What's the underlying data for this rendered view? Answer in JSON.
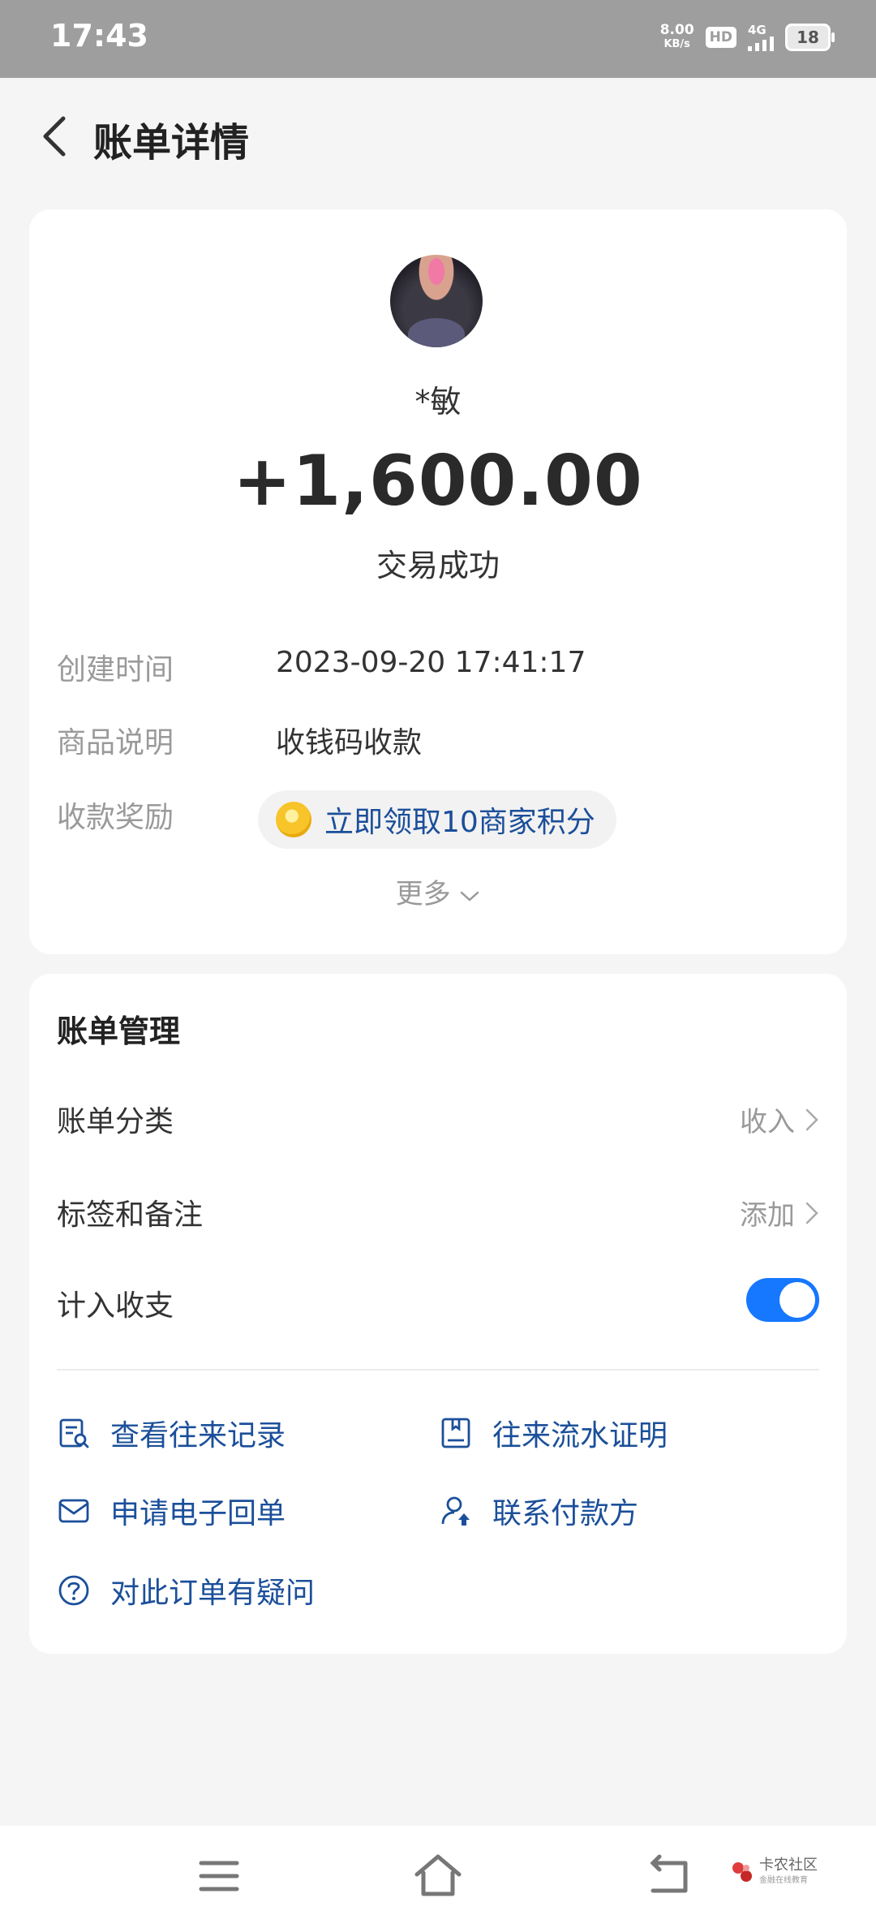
{
  "status_bar": {
    "time": "17:43",
    "speed_value": "8.00",
    "speed_unit": "KB/s",
    "hd": "HD",
    "network": "4G",
    "battery": "18"
  },
  "header": {
    "title": "账单详情"
  },
  "transaction": {
    "payer": "*敏",
    "amount": "+1,600.00",
    "status": "交易成功",
    "details": [
      {
        "label": "创建时间",
        "value": "2023-09-20 17:41:17"
      },
      {
        "label": "商品说明",
        "value": "收钱码收款"
      }
    ],
    "reward": {
      "label": "收款奖励",
      "text": "立即领取10商家积分"
    },
    "more": "更多"
  },
  "management": {
    "title": "账单管理",
    "category": {
      "label": "账单分类",
      "value": "收入"
    },
    "tags": {
      "label": "标签和备注",
      "value": "添加"
    },
    "count_in_stats": {
      "label": "计入收支",
      "enabled": true
    },
    "links": [
      {
        "label": "查看往来记录",
        "icon": "record-search-icon"
      },
      {
        "label": "往来流水证明",
        "icon": "statement-icon"
      },
      {
        "label": "申请电子回单",
        "icon": "envelope-icon"
      },
      {
        "label": "联系付款方",
        "icon": "contact-person-icon"
      },
      {
        "label": "对此订单有疑问",
        "icon": "question-icon"
      }
    ]
  },
  "watermark": {
    "title": "卡农社区",
    "subtitle": "金融在线教育"
  },
  "colors": {
    "accent": "#1677ff",
    "link": "#1b4f9a",
    "background": "#f5f5f5"
  }
}
